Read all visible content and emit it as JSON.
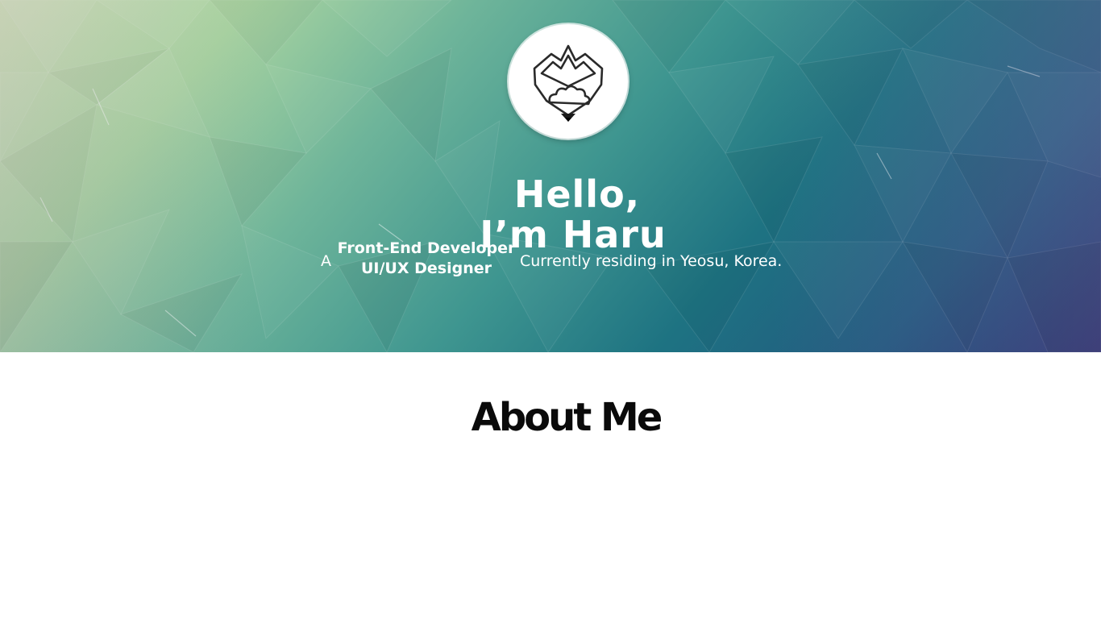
{
  "hero": {
    "logo_icon": "mountain-heart-logo-icon",
    "greeting_line1": "Hello,",
    "greeting_line2": "I’m Haru",
    "tagline": {
      "prefix": "A",
      "roles": [
        "Front-End Developer",
        "UI/UX Designer"
      ],
      "suffix": "Currently residing in Yeosu, Korea."
    },
    "gradient_colors": [
      "#d3e6b8",
      "#6fb59a",
      "#1e7382",
      "#232d6e"
    ]
  },
  "about": {
    "title": "About Me"
  }
}
